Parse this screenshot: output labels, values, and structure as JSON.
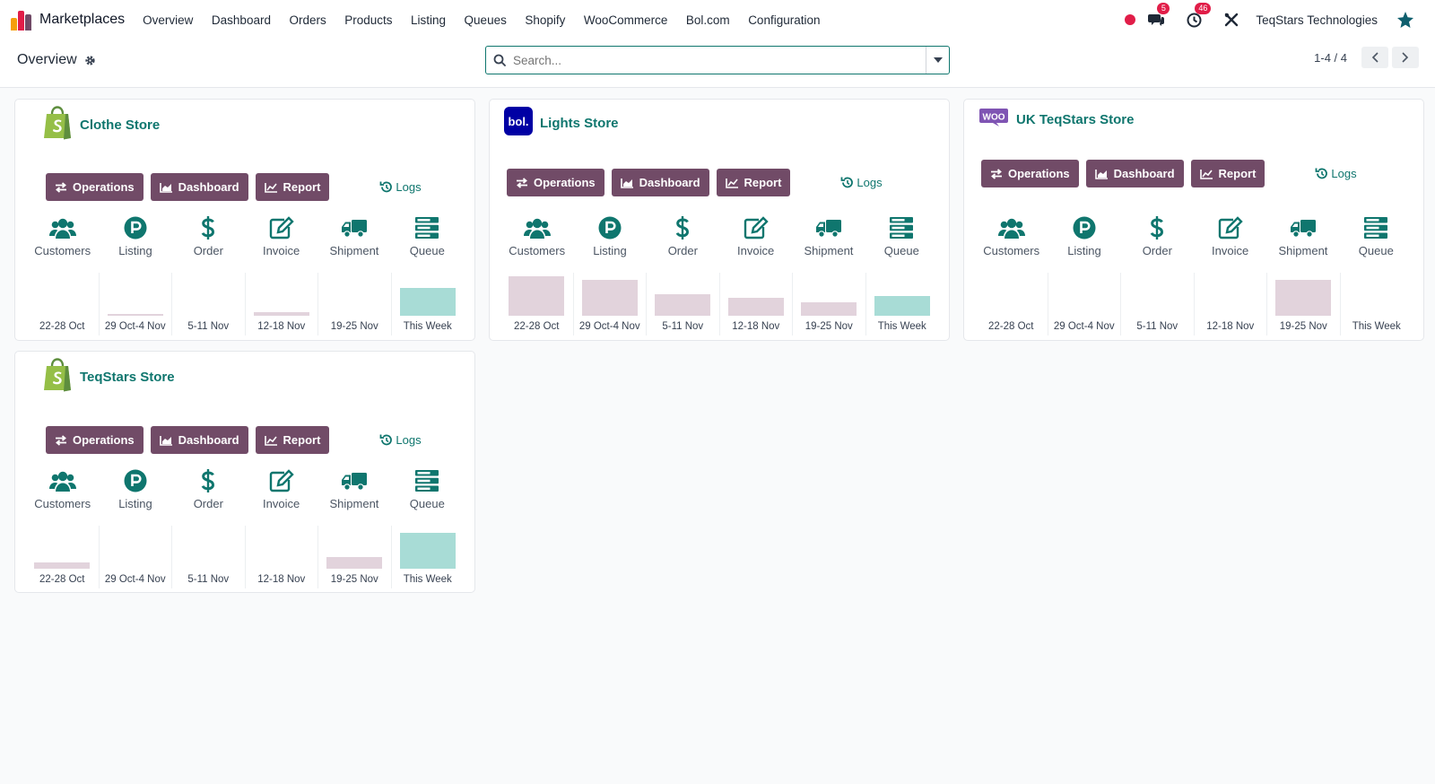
{
  "app": {
    "title": "Marketplaces",
    "nav": [
      "Overview",
      "Dashboard",
      "Orders",
      "Products",
      "Listing",
      "Queues",
      "Shopify",
      "WooCommerce",
      "Bol.com",
      "Configuration"
    ],
    "messages_badge": "5",
    "activities_badge": "46",
    "company": "TeqStars Technologies"
  },
  "control": {
    "page_title": "Overview",
    "search_placeholder": "Search...",
    "pager": "1-4 / 4"
  },
  "colors": {
    "primary": "#714b67",
    "teal": "#0f766e",
    "bar_past": "#e2d3dc",
    "bar_current": "#a8dcd6"
  },
  "buttons": {
    "operations": "Operations",
    "dashboard": "Dashboard",
    "report": "Report",
    "logs": "Logs"
  },
  "icon_labels": [
    "Customers",
    "Listing",
    "Order",
    "Invoice",
    "Shipment",
    "Queue"
  ],
  "week_labels": [
    "22-28 Oct",
    "29 Oct-4 Nov",
    "5-11 Nov",
    "12-18 Nov",
    "19-25 Nov",
    "This Week"
  ],
  "stores": [
    {
      "name": "Clothe Store",
      "platform": "shopify",
      "chart_data": {
        "type": "bar",
        "categories": [
          "22-28 Oct",
          "29 Oct-4 Nov",
          "5-11 Nov",
          "12-18 Nov",
          "19-25 Nov",
          "This Week"
        ],
        "values": [
          0,
          0.04,
          0,
          0.08,
          0,
          0.7
        ]
      }
    },
    {
      "name": "Lights Store",
      "platform": "bol",
      "chart_data": {
        "type": "bar",
        "categories": [
          "22-28 Oct",
          "29 Oct-4 Nov",
          "5-11 Nov",
          "12-18 Nov",
          "19-25 Nov",
          "This Week"
        ],
        "values": [
          1.0,
          0.9,
          0.55,
          0.45,
          0.35,
          0.5
        ]
      }
    },
    {
      "name": "UK TeqStars Store",
      "platform": "woo",
      "chart_data": {
        "type": "bar",
        "categories": [
          "22-28 Oct",
          "29 Oct-4 Nov",
          "5-11 Nov",
          "12-18 Nov",
          "19-25 Nov",
          "This Week"
        ],
        "values": [
          0,
          0,
          0,
          0,
          0.9,
          0
        ]
      }
    },
    {
      "name": "TeqStars Store",
      "platform": "shopify",
      "chart_data": {
        "type": "bar",
        "categories": [
          "22-28 Oct",
          "29 Oct-4 Nov",
          "5-11 Nov",
          "12-18 Nov",
          "19-25 Nov",
          "This Week"
        ],
        "values": [
          0.15,
          0,
          0,
          0,
          0.3,
          0.9
        ]
      }
    }
  ]
}
